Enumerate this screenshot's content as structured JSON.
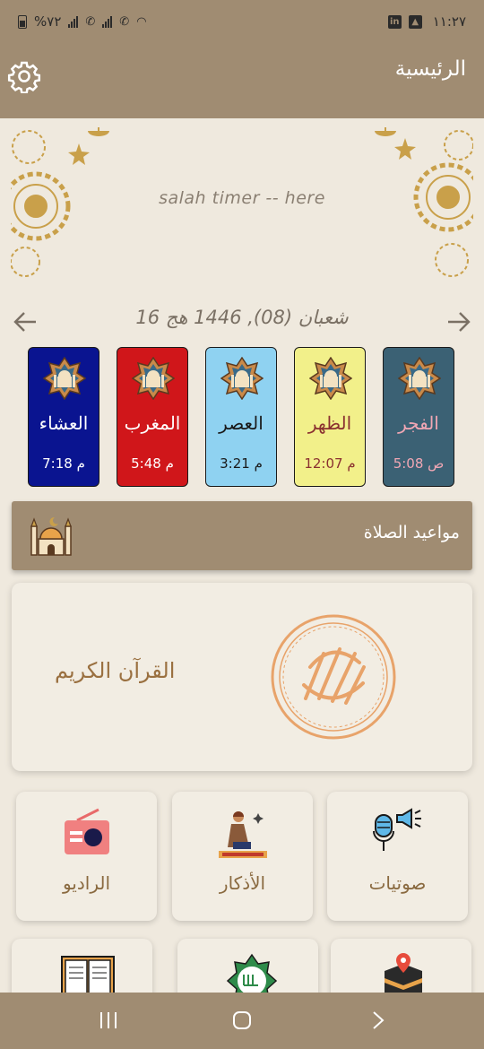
{
  "status_bar": {
    "time": "١١:٢٧",
    "battery": "%٧٢"
  },
  "app_bar": {
    "title": "الرئيسية"
  },
  "banner": {
    "timer_text": "salah timer  -- here"
  },
  "date_bar": {
    "hijri_date": "16  شعبان (08), 1446 هج"
  },
  "prayers": [
    {
      "name": "الفجر",
      "time": "5:08 ص",
      "bg": "#3b6174",
      "text_color": "#f1a7b4"
    },
    {
      "name": "الظهر",
      "time": "12:07 م",
      "bg": "#f2f08a",
      "text_color": "#8a3030"
    },
    {
      "name": "العصر",
      "time": "3:21 م",
      "bg": "#8fd2f1",
      "text_color": "#1a1a1a"
    },
    {
      "name": "المغرب",
      "time": "5:48 م",
      "bg": "#d0161a",
      "text_color": "#ffffff"
    },
    {
      "name": "العشاء",
      "time": "7:18 م",
      "bg": "#0a1490",
      "text_color": "#ffffff"
    }
  ],
  "prayer_section": {
    "title": "مواعيد الصلاة"
  },
  "quran": {
    "label": "القرآن الكريم"
  },
  "tiles": [
    {
      "label": "الراديو",
      "icon": "radio-icon"
    },
    {
      "label": "الأذكار",
      "icon": "praying-man-icon"
    },
    {
      "label": "صوتيات",
      "icon": "microphone-speaker-icon"
    }
  ],
  "lower_tiles": [
    {
      "icon": "open-book-icon"
    },
    {
      "icon": "allah-calligraphy-icon"
    },
    {
      "icon": "kaaba-location-icon"
    }
  ],
  "colors": {
    "primary": "#a08c72",
    "background": "#efe9de",
    "card": "#f2ede3",
    "gold": "#c9a04a",
    "accent_text": "#9a7040"
  }
}
